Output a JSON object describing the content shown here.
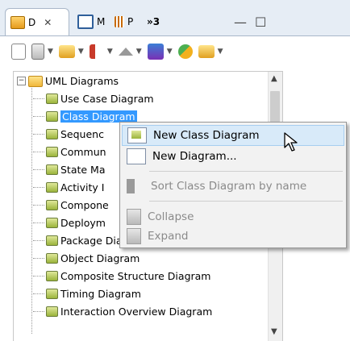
{
  "tabs": [
    {
      "label": "D",
      "close": "✕",
      "active": true
    },
    {
      "label": "M",
      "active": false
    },
    {
      "label": "P",
      "active": false
    },
    {
      "label": "»3",
      "active": false
    }
  ],
  "window_buttons": {
    "minimize": "—",
    "maximize": "☐"
  },
  "tree": {
    "root": "UML Diagrams",
    "items": [
      {
        "label": "Use Case Diagram"
      },
      {
        "label": "Class Diagram",
        "selected": true
      },
      {
        "label": "Sequenc"
      },
      {
        "label": "Commun"
      },
      {
        "label": "State Ma"
      },
      {
        "label": "Activity I"
      },
      {
        "label": "Compone"
      },
      {
        "label": "Deploym"
      },
      {
        "label": "Package Diagram"
      },
      {
        "label": "Object Diagram"
      },
      {
        "label": "Composite Structure Diagram"
      },
      {
        "label": "Timing Diagram"
      },
      {
        "label": "Interaction Overview Diagram"
      }
    ]
  },
  "context_menu": {
    "new_class_diagram": "New Class Diagram",
    "new_diagram": "New Diagram...",
    "sort": "Sort Class Diagram by name",
    "collapse": "Collapse",
    "expand": "Expand"
  },
  "colors": {
    "selection": "#3399ff",
    "menu_highlight": "#d8eaf9",
    "tab_bar": "#e6edf5"
  }
}
